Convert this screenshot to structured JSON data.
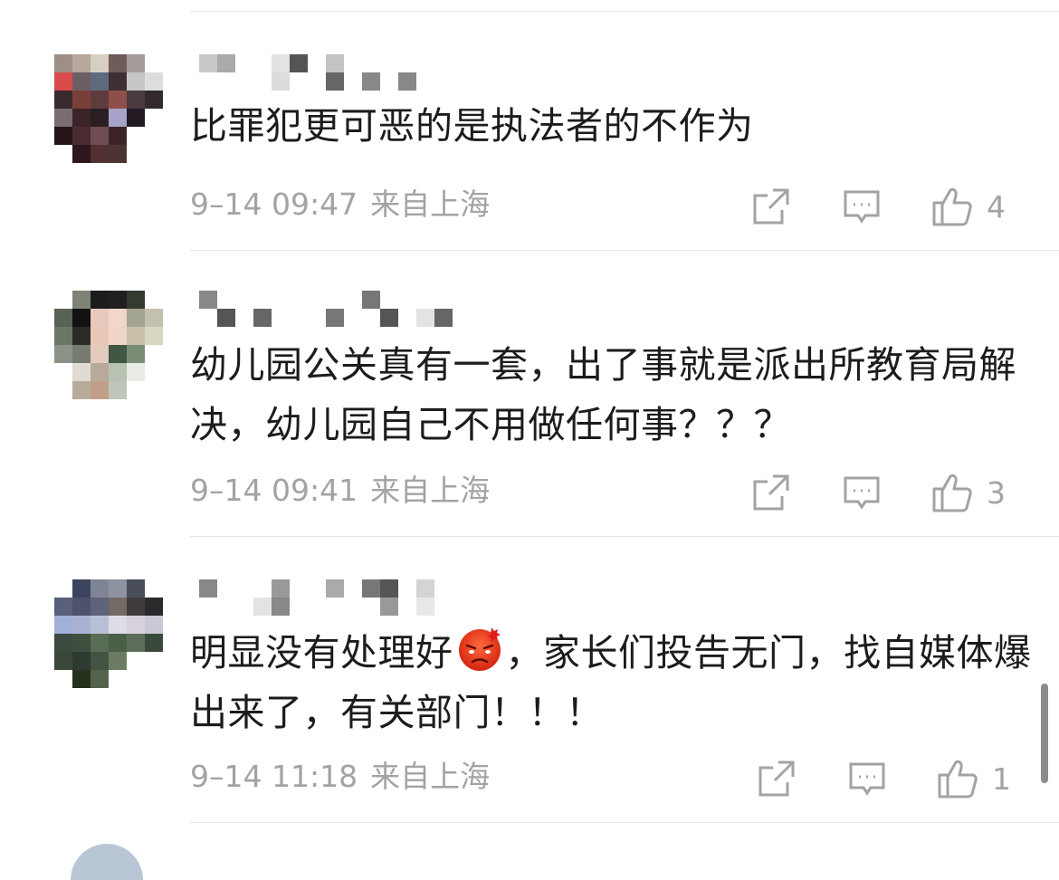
{
  "comments": [
    {
      "text": "比罪犯更可恶的是执法者的不作为",
      "date": "9–14 09:47",
      "location": "来自上海",
      "likes": "4",
      "avatar_pixelated": true,
      "username_pixelated": true
    },
    {
      "text": "幼儿园公关真有一套，出了事就是派出所教育局解决，幼儿园自己不用做任何事？？？",
      "date": "9–14 09:41",
      "location": "来自上海",
      "likes": "3",
      "avatar_pixelated": true,
      "username_pixelated": true
    },
    {
      "text_before_emoji": "明显没有处理好",
      "emoji": "angry-face-emoji",
      "text_after_emoji": "，家长们投告无门，找自媒体爆出来了，有关部门！！！",
      "date": "9–14 11:18",
      "location": "来自上海",
      "likes": "1",
      "avatar_pixelated": true,
      "username_pixelated": true
    }
  ],
  "icons": {
    "share": "share-icon",
    "reply": "comment-icon",
    "like": "thumbs-up-icon"
  },
  "colors": {
    "meta_text": "#a3a3a3",
    "divider": "#e6e6e6",
    "body_text": "#1c1c1c"
  }
}
